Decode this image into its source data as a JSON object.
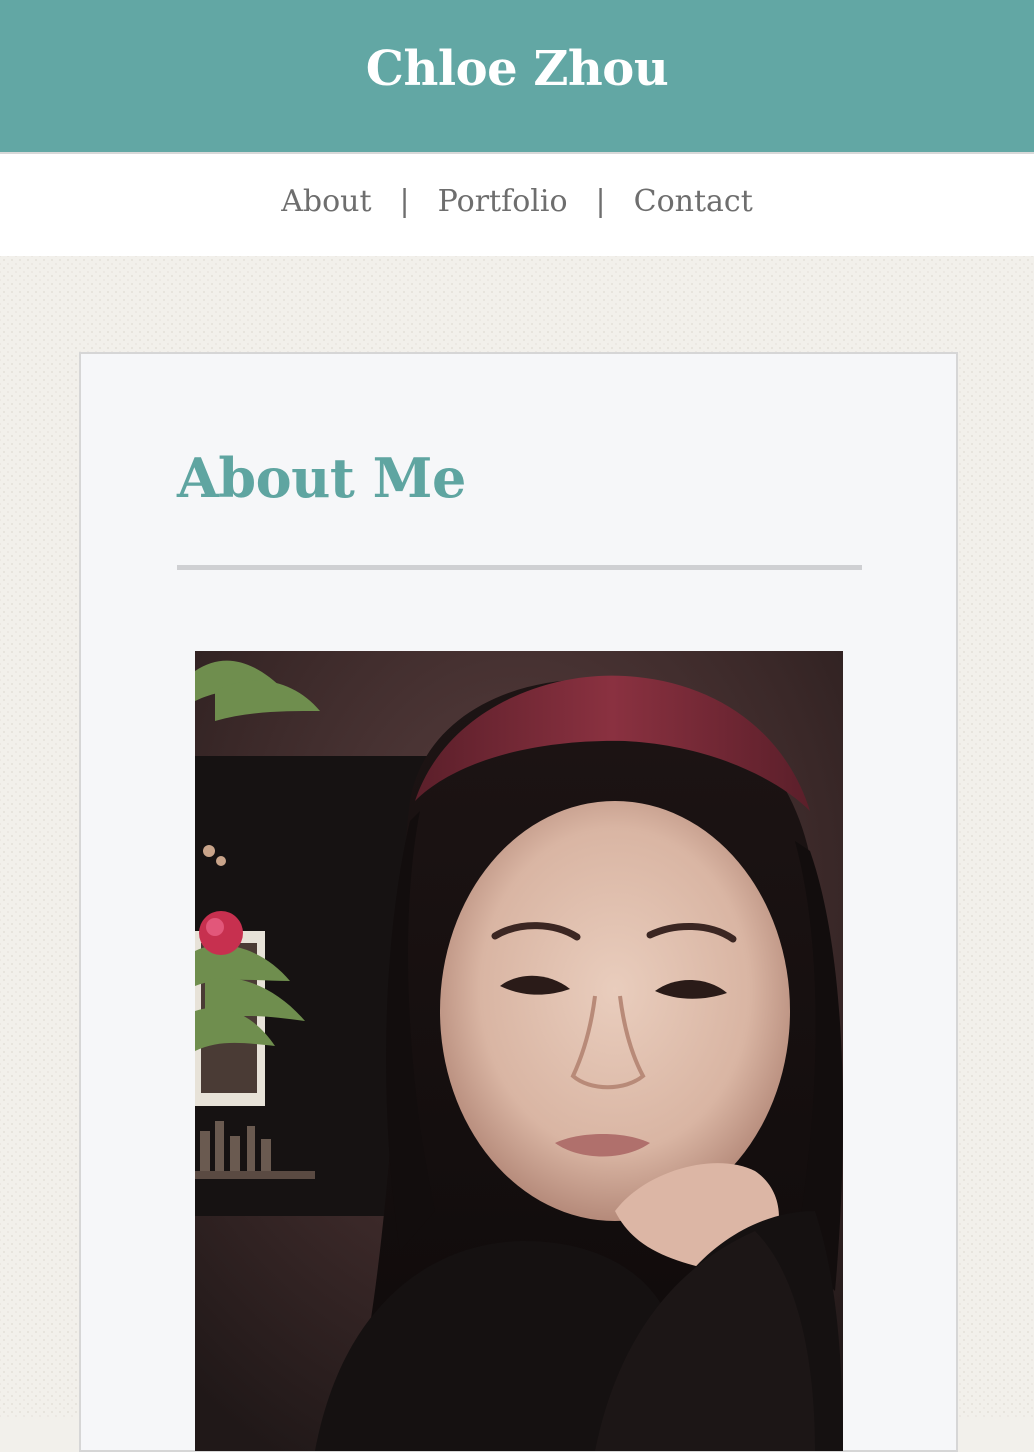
{
  "site": {
    "title": "Chloe Zhou"
  },
  "nav": {
    "items": [
      "About",
      "Portfolio",
      "Contact"
    ],
    "separator": "|"
  },
  "main": {
    "heading": "About Me",
    "photo_icon": "portrait-photo"
  },
  "colors": {
    "header_bg": "#62a7a4",
    "heading": "#5fa5a1",
    "nav_text": "#6e6e6e",
    "page_bg": "#f2f0eb",
    "card_bg": "#f6f7f9"
  }
}
